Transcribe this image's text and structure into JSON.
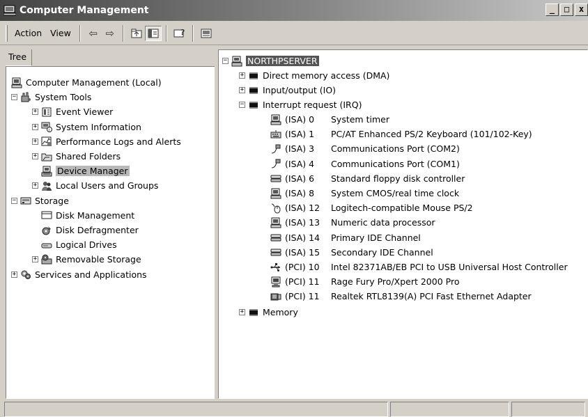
{
  "window": {
    "title": "Computer Management"
  },
  "menu": {
    "action": "Action",
    "view": "View"
  },
  "left": {
    "tab_label": "Tree",
    "items": [
      {
        "label": "Computer Management (Local)"
      },
      {
        "label": "System Tools"
      },
      {
        "label": "Event Viewer"
      },
      {
        "label": "System Information"
      },
      {
        "label": "Performance Logs and Alerts"
      },
      {
        "label": "Shared Folders"
      },
      {
        "label": "Device Manager"
      },
      {
        "label": "Local Users and Groups"
      },
      {
        "label": "Storage"
      },
      {
        "label": "Disk Management"
      },
      {
        "label": "Disk Defragmenter"
      },
      {
        "label": "Logical Drives"
      },
      {
        "label": "Removable Storage"
      },
      {
        "label": "Services and Applications"
      }
    ]
  },
  "right": {
    "root": "NORTHPSERVER",
    "categories": {
      "dma": "Direct memory access (DMA)",
      "io": "Input/output (IO)",
      "irq": "Interrupt request (IRQ)",
      "memory": "Memory"
    },
    "irq_entries": [
      {
        "code": "(ISA) 0",
        "device": "System timer",
        "icon": "computer-icon"
      },
      {
        "code": "(ISA) 1",
        "device": "PC/AT Enhanced PS/2 Keyboard (101/102-Key)",
        "icon": "keyboard-icon"
      },
      {
        "code": "(ISA) 3",
        "device": "Communications Port (COM2)",
        "icon": "port-icon"
      },
      {
        "code": "(ISA) 4",
        "device": "Communications Port (COM1)",
        "icon": "port-icon"
      },
      {
        "code": "(ISA) 6",
        "device": "Standard floppy disk controller",
        "icon": "disk-controller-icon"
      },
      {
        "code": "(ISA) 8",
        "device": "System CMOS/real time clock",
        "icon": "computer-icon"
      },
      {
        "code": "(ISA) 12",
        "device": "Logitech-compatible Mouse PS/2",
        "icon": "mouse-icon"
      },
      {
        "code": "(ISA) 13",
        "device": "Numeric data processor",
        "icon": "computer-icon"
      },
      {
        "code": "(ISA) 14",
        "device": "Primary IDE Channel",
        "icon": "disk-controller-icon"
      },
      {
        "code": "(ISA) 15",
        "device": "Secondary IDE Channel",
        "icon": "disk-controller-icon"
      },
      {
        "code": "(PCI) 10",
        "device": "Intel 82371AB/EB PCI to USB Universal Host Controller",
        "icon": "usb-icon"
      },
      {
        "code": "(PCI) 11",
        "device": "Rage Fury Pro/Xpert 2000 Pro",
        "icon": "monitor-icon"
      },
      {
        "code": "(PCI) 11",
        "device": "Realtek RTL8139(A) PCI Fast Ethernet Adapter",
        "icon": "network-adapter-icon"
      }
    ]
  }
}
